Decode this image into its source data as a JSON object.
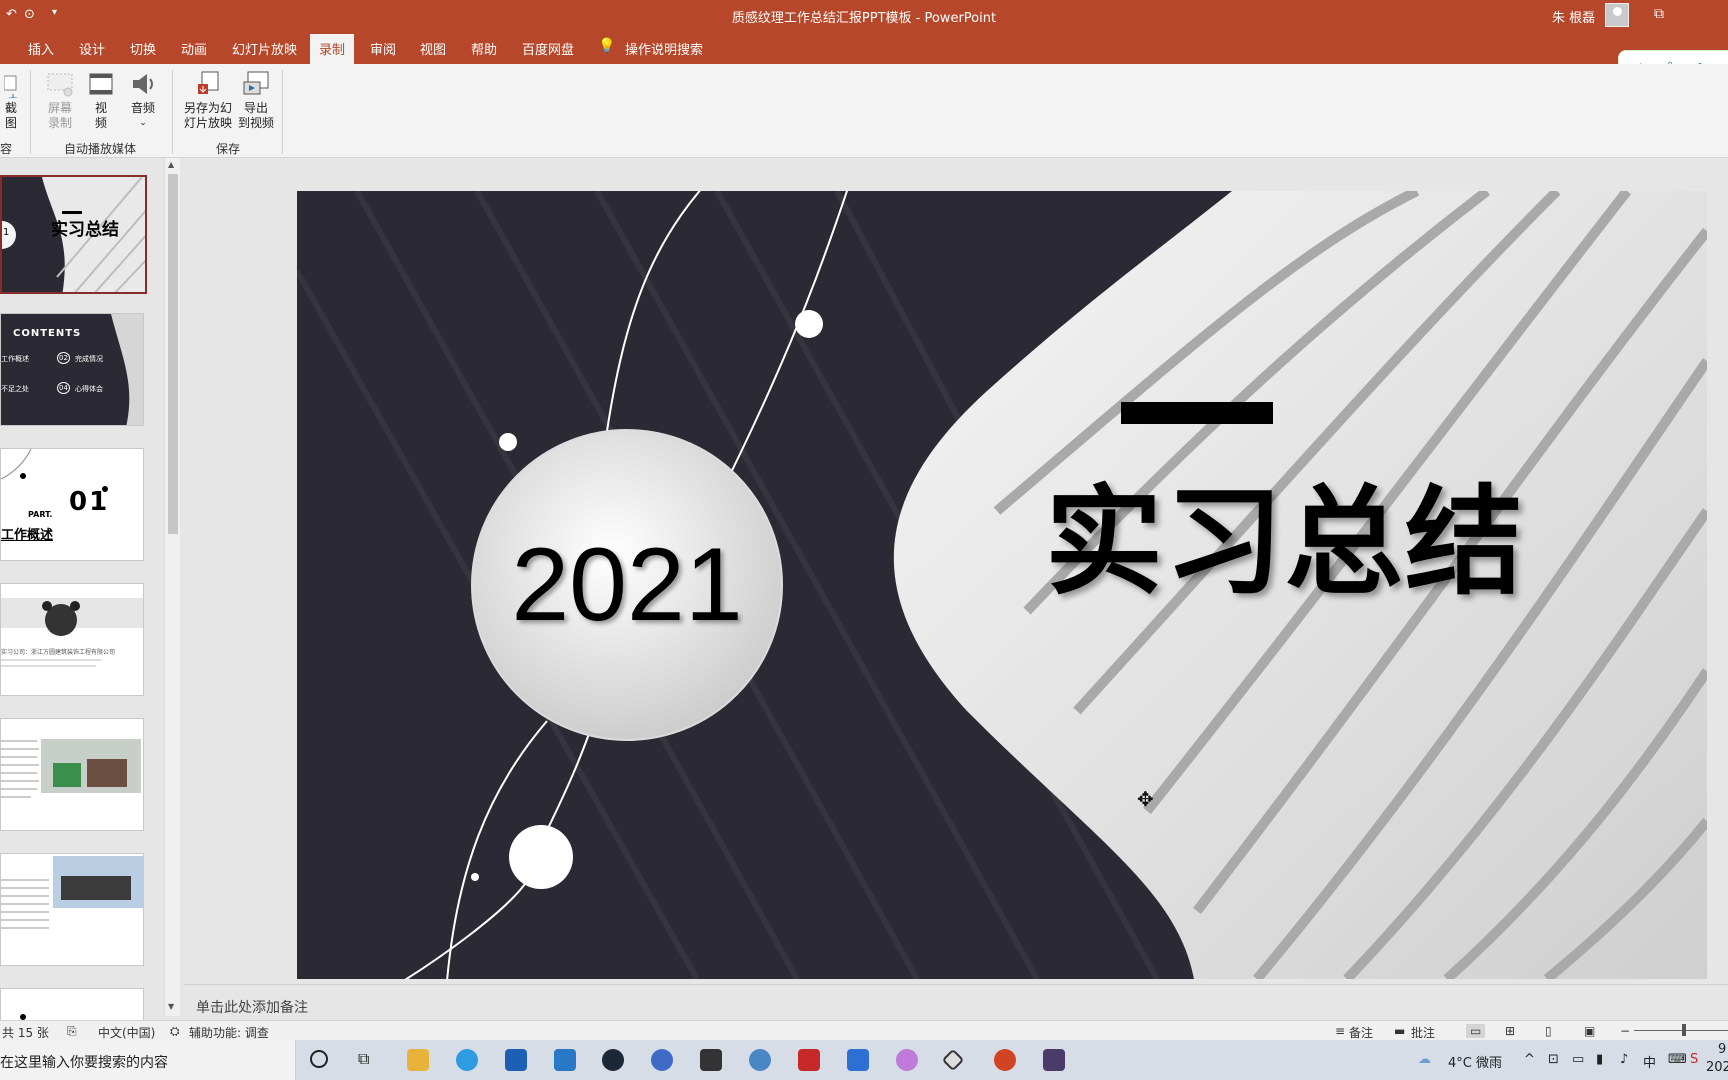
{
  "titlebar": {
    "title": "质感纹理工作总结汇报PPT模板  -  PowerPoint",
    "user": "朱 根磊"
  },
  "tabs": [
    "插入",
    "设计",
    "切换",
    "动画",
    "幻灯片放映",
    "录制",
    "审阅",
    "视图",
    "帮助",
    "百度网盘",
    "操作说明搜索"
  ],
  "ime": {
    "lang": "中",
    "punct": "°,",
    "shirt": "👕"
  },
  "ribbon": {
    "buttons": {
      "screenshot_partial": "截图",
      "screen_record_1": "屏幕",
      "screen_record_2": "录制",
      "video_1": "视",
      "video_2": "频",
      "audio": "音频",
      "save_show_1": "另存为幻",
      "save_show_2": "灯片放映",
      "export_video_1": "导出",
      "export_video_2": "到视频"
    },
    "groups": {
      "content_partial": "容",
      "autoplay_media": "自动播放媒体",
      "save": "保存"
    }
  },
  "thumbnails": {
    "t1_title": "实习总结",
    "t1_num": "1",
    "t2_header": "CONTENTS",
    "t2_items": [
      "工作概述",
      "完成情况",
      "不足之处",
      "心得体会"
    ],
    "t2_nums": [
      "02",
      "04"
    ],
    "t3_part": "PART.",
    "t3_num": "01",
    "t3_title": "工作概述",
    "t4_text": "实习公司：浙江方圆建筑装饰工程有限公司"
  },
  "slide": {
    "year": "2021",
    "title": "实习总结"
  },
  "notes_placeholder": "单击此处添加备注",
  "status": {
    "slide_count": "共 15 张",
    "language": "中文(中国)",
    "accessibility": "辅助功能: 调查",
    "notes": "备注",
    "comments": "批注",
    "zoom_minus": "−"
  },
  "taskbar": {
    "search_placeholder": "在这里输入你要搜索的内容",
    "weather": "4°C 微雨",
    "ime": "中",
    "date_partial": "202",
    "time_partial": "9"
  }
}
